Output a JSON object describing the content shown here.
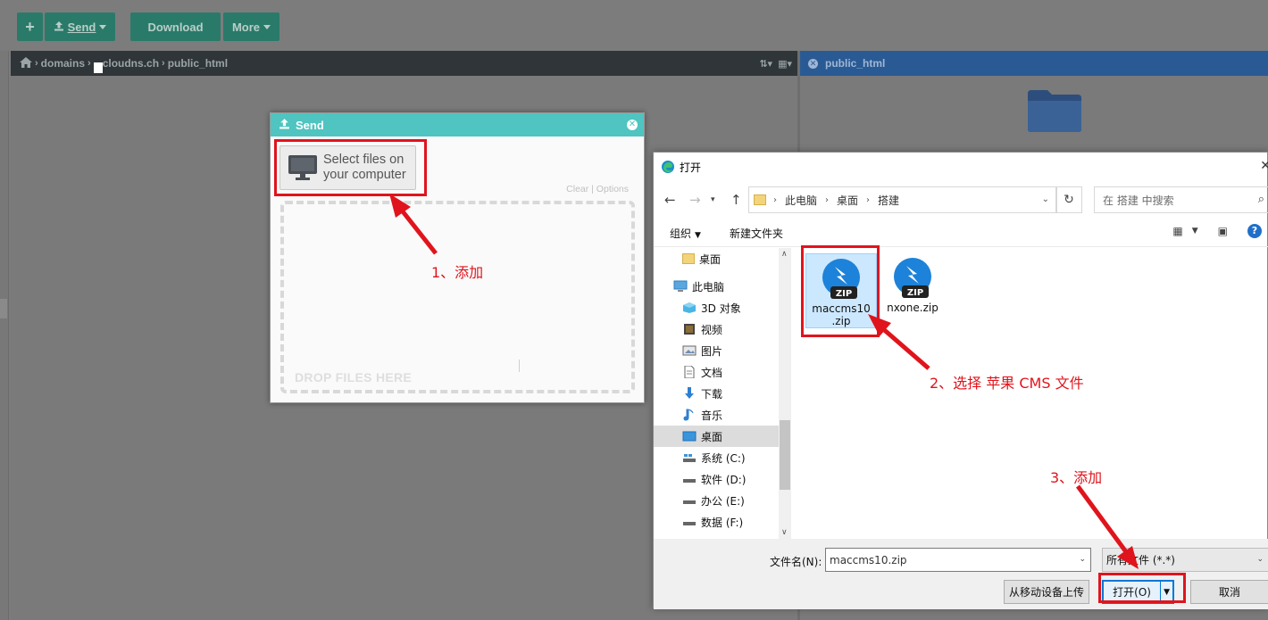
{
  "toolbar": {
    "add_label": "+",
    "send_label": "Send",
    "download_label": "Download",
    "more_label": "More"
  },
  "breadcrumb": {
    "items": [
      "domains",
      "cloudns.ch",
      "public_html"
    ]
  },
  "right_panel": {
    "title": "public_html"
  },
  "send_dialog": {
    "title": "Send",
    "select_line1": "Select files on",
    "select_line2": "your computer",
    "clear_options": "Clear | Options",
    "drop_label": "DROP FILES HERE"
  },
  "open_dialog": {
    "title": "打开",
    "path": [
      "此电脑",
      "桌面",
      "搭建"
    ],
    "search_placeholder": "在 搭建 中搜索",
    "organize": "组织",
    "new_folder": "新建文件夹",
    "nav_items": [
      {
        "label": "桌面",
        "icon": "folder-icon"
      },
      {
        "label": "此电脑",
        "icon": "computer-icon"
      },
      {
        "label": "3D 对象",
        "icon": "3d-objects-icon"
      },
      {
        "label": "视频",
        "icon": "video-icon"
      },
      {
        "label": "图片",
        "icon": "pictures-icon"
      },
      {
        "label": "文档",
        "icon": "documents-icon"
      },
      {
        "label": "下载",
        "icon": "download-icon"
      },
      {
        "label": "音乐",
        "icon": "music-icon"
      },
      {
        "label": "桌面",
        "icon": "desktop-icon"
      },
      {
        "label": "系统 (C:)",
        "icon": "drive-icon"
      },
      {
        "label": "软件 (D:)",
        "icon": "drive-icon"
      },
      {
        "label": "办公 (E:)",
        "icon": "drive-icon"
      },
      {
        "label": "数据 (F:)",
        "icon": "drive-icon"
      }
    ],
    "files": [
      {
        "line1": "maccms10",
        "line2": ".zip"
      },
      {
        "line1": "nxone.zip",
        "line2": ""
      }
    ],
    "filename_label": "文件名(N):",
    "filename_value": "maccms10.zip",
    "filetype_value": "所有文件 (*.*)",
    "upload_mobile": "从移动设备上传",
    "open_label": "打开(O)",
    "cancel_label": "取消"
  },
  "annotations": {
    "step1": "1、添加",
    "step2": "2、选择 苹果 CMS 文件",
    "step3": "3、添加"
  },
  "colors": {
    "accent_red": "#e0141c",
    "send_title": "#4fc4c0",
    "right_header": "#2a5a94",
    "toolbar_button": "#2a7a6a"
  }
}
